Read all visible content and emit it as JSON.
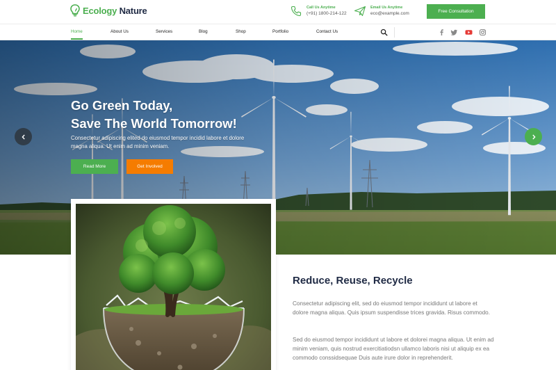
{
  "brand": {
    "name_green": "Ecology",
    "name_dark": "Nature",
    "logo_icon": "lightbulb-leaf-icon"
  },
  "contacts": [
    {
      "label": "Call Us Anytime",
      "value": "(+91) 1800-214-122",
      "icon": "phone-icon"
    },
    {
      "label": "Email Us Anytime",
      "value": "eco@example.com",
      "icon": "paper-plane-icon"
    }
  ],
  "cta": {
    "consult_label": "Free Consultation"
  },
  "nav": {
    "items": [
      "Home",
      "About Us",
      "Services",
      "Blog",
      "Shop",
      "Portfolio",
      "Contact Us"
    ],
    "active": "Home",
    "search_icon": "search-icon",
    "social": [
      "facebook-icon",
      "twitter-icon",
      "youtube-icon",
      "instagram-icon"
    ]
  },
  "hero": {
    "title_line1": "Go Green Today,",
    "title_line2": "Save The World Tomorrow!",
    "text": "Consectetur adipiscing elited do eiusmod tempor incidid labore et dolore magna aliqua. Ut enim ad minim veniam.",
    "btn_primary": "Read More",
    "btn_secondary": "Get Involved",
    "prev_icon": "chevron-left-icon",
    "next_icon": "chevron-right-icon"
  },
  "about": {
    "title": "Reduce, Reuse, Recycle",
    "para1": "Consectetur adipiscing elit, sed do eiusmod tempor incididunt ut labore et dolore magna aliqua. Quis ipsum suspendisse trices gravida. Risus commodo.",
    "para2": "Sed do eiusmod tempor incididunt ut labore et dolorei magna aliqua. Ut enim ad minim veniam, quis nostrud exercitiatiodsn ullamco laboris nisi ut aliquip ex ea commodo conssidsequae Duis aute irure dolor in reprehenderit."
  },
  "colors": {
    "accent": "#4caf50",
    "accent_orange": "#f57c00",
    "heading": "#1f2a44",
    "body_text": "#777777"
  }
}
